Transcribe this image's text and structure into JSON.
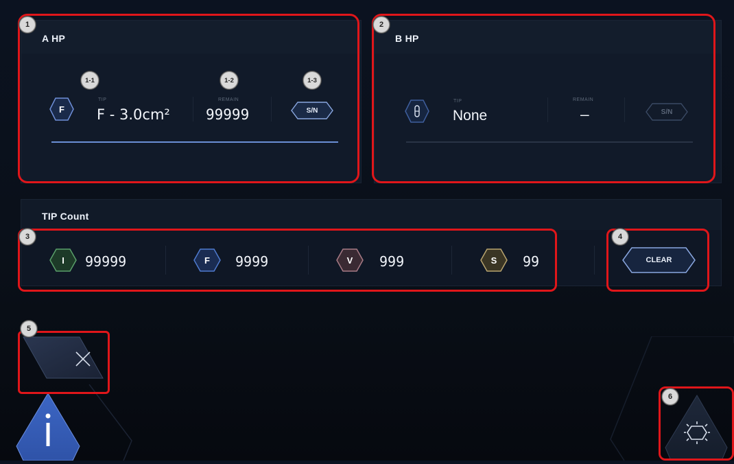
{
  "a_hp": {
    "title": "A HP",
    "tip_icon_letter": "F",
    "tip_label": "TIP",
    "tip_value": "F - 3.0cm²",
    "remain_label": "REMAIN",
    "remain_value": "99999",
    "sn_label": "S/N"
  },
  "b_hp": {
    "title": "B HP",
    "tip_label": "TIP",
    "tip_value": "None",
    "remain_label": "REMAIN",
    "remain_value": "–",
    "sn_label": "S/N"
  },
  "tip_count": {
    "title": "TIP Count",
    "items": [
      {
        "letter": "I",
        "value": "99999",
        "color": "#5aa06a"
      },
      {
        "letter": "F",
        "value": "9999",
        "color": "#4f7bd0"
      },
      {
        "letter": "V",
        "value": "999",
        "color": "#a77b86"
      },
      {
        "letter": "S",
        "value": "99",
        "color": "#b9a56f"
      }
    ],
    "clear_label": "CLEAR"
  },
  "annotations": {
    "n1": "1",
    "n1_1": "1-1",
    "n1_2": "1-2",
    "n1_3": "1-3",
    "n2": "2",
    "n3": "3",
    "n4": "4",
    "n5": "5",
    "n6": "6"
  },
  "icons": {
    "close": "close-icon",
    "info": "info-icon",
    "settings": "sun-settings-icon"
  },
  "colors": {
    "annotation_red": "#e0161a",
    "accent_blue": "#4f7bd0"
  }
}
